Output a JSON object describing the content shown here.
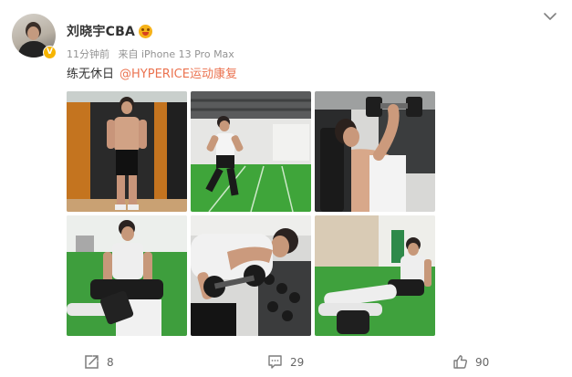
{
  "post": {
    "author": {
      "name": "刘晓宇CBA",
      "verified_badge": "V",
      "emoji_icon": "surprised-face-icon"
    },
    "meta": {
      "time": "11分钟前",
      "source": "来自 iPhone 13 Pro Max"
    },
    "content": {
      "text": "练无休日",
      "mention": "@HYPERICE运动康复"
    },
    "photos": [
      {
        "icon": "photo-shirtless-standing-court"
      },
      {
        "icon": "photo-running-turf-gym"
      },
      {
        "icon": "photo-dumbbell-shoulder-press"
      },
      {
        "icon": "photo-seated-foam-roller"
      },
      {
        "icon": "photo-dumbbell-row"
      },
      {
        "icon": "photo-foam-roller-leg"
      }
    ],
    "actions": {
      "repost_count": "8",
      "comment_count": "29",
      "like_count": "90"
    }
  },
  "colors": {
    "accent_link": "#eb7350",
    "meta_gray": "#939393",
    "verified_gold": "#f7b500"
  }
}
